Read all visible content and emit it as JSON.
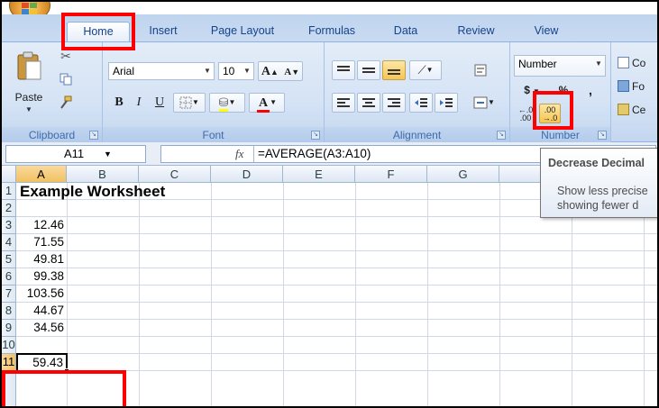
{
  "tabs": [
    "Home",
    "Insert",
    "Page Layout",
    "Formulas",
    "Data",
    "Review",
    "View"
  ],
  "ribbon": {
    "clipboard": {
      "label": "Clipboard",
      "paste": "Paste"
    },
    "font": {
      "label": "Font",
      "font_name": "Arial",
      "font_size": "10",
      "bold": "B",
      "italic": "I",
      "underline": "U",
      "grow": "A",
      "shrink": "A"
    },
    "alignment": {
      "label": "Alignment"
    },
    "number": {
      "label": "Number",
      "format": "Number",
      "currency": "$",
      "percent": "%",
      "comma": ",",
      "increase_decimal": ".0←.00",
      "decrease_decimal": ".00→.0"
    },
    "styles": {
      "items": [
        "Co",
        "Fo",
        "Ce"
      ]
    }
  },
  "formula_bar": {
    "name_box": "A11",
    "fx": "fx",
    "formula": "=AVERAGE(A3:A10)"
  },
  "columns": [
    "A",
    "B",
    "C",
    "D",
    "E",
    "F",
    "G"
  ],
  "rows": [
    "1",
    "2",
    "3",
    "4",
    "5",
    "6",
    "7",
    "8",
    "9",
    "10",
    "11"
  ],
  "cells": {
    "title": "Example Worksheet",
    "values": [
      "12.46",
      "71.55",
      "49.81",
      "99.38",
      "103.56",
      "44.67",
      "34.56"
    ],
    "active_value": "59.43"
  },
  "tooltip": {
    "title": "Decrease Decimal",
    "line1": "Show less precise",
    "line2": "showing fewer d"
  },
  "colors": {
    "highlight": "#ff0000",
    "ribbon": "#dbe6f4",
    "selection_header": "#f1c15f"
  }
}
